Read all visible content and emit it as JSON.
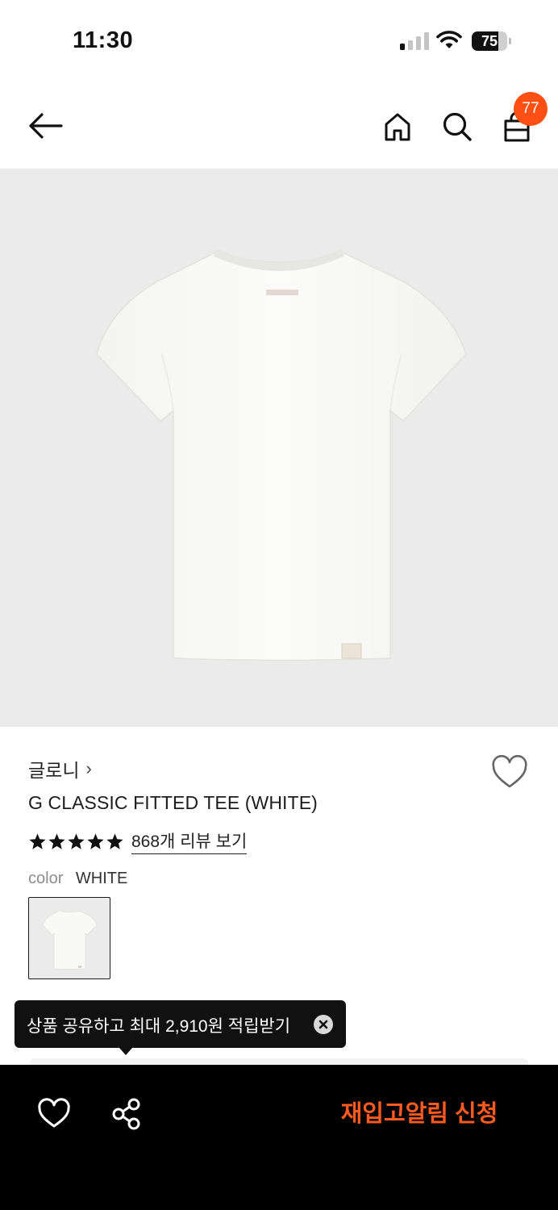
{
  "status_bar": {
    "time": "11:30",
    "battery_level": "75",
    "battery_fraction": 0.75
  },
  "nav": {
    "cart_count": "77",
    "icons": [
      "back-arrow-icon",
      "home-icon",
      "search-icon",
      "shopping-bag-icon"
    ]
  },
  "product": {
    "brand": "글로니",
    "brand_chevron": "›",
    "name": "G CLASSIC FITTED TEE (WHITE)",
    "rating_stars": 5,
    "review_link": "868개 리뷰 보기",
    "color_label": "color",
    "color_value": "WHITE"
  },
  "tooltip": {
    "text": "상품 공유하고 최대 2,910원 적립받기"
  },
  "bottom_bar": {
    "restock_label": "재입고알림 신청"
  },
  "colors": {
    "accent": "#ff4f12",
    "restock_text": "#ff5a1f",
    "image_bg": "#ebebeb",
    "bottom_bar_bg": "#000000"
  }
}
